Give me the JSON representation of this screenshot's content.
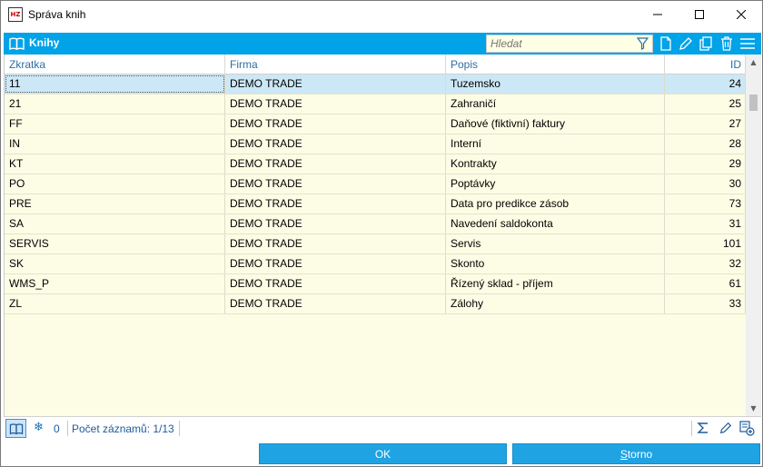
{
  "window": {
    "title": "Správa knih",
    "app_icon_text": "HZ"
  },
  "panel": {
    "title": "Knihy",
    "search_placeholder": "Hledat"
  },
  "grid": {
    "columns": [
      "Zkratka",
      "Firma",
      "Popis",
      "ID"
    ],
    "rows": [
      {
        "zkratka": "11",
        "firma": "DEMO TRADE",
        "popis": "Tuzemsko",
        "id": "24",
        "selected": true
      },
      {
        "zkratka": "21",
        "firma": "DEMO TRADE",
        "popis": "Zahraničí",
        "id": "25"
      },
      {
        "zkratka": "FF",
        "firma": "DEMO TRADE",
        "popis": "Daňové (fiktivní) faktury",
        "id": "27"
      },
      {
        "zkratka": "IN",
        "firma": "DEMO TRADE",
        "popis": "Interní",
        "id": "28"
      },
      {
        "zkratka": "KT",
        "firma": "DEMO TRADE",
        "popis": "Kontrakty",
        "id": "29"
      },
      {
        "zkratka": "PO",
        "firma": "DEMO TRADE",
        "popis": "Poptávky",
        "id": "30"
      },
      {
        "zkratka": "PRE",
        "firma": "DEMO TRADE",
        "popis": "Data pro predikce zásob",
        "id": "73"
      },
      {
        "zkratka": "SA",
        "firma": "DEMO TRADE",
        "popis": "Navedení saldokonta",
        "id": "31"
      },
      {
        "zkratka": "SERVIS",
        "firma": "DEMO TRADE",
        "popis": "Servis",
        "id": "101"
      },
      {
        "zkratka": "SK",
        "firma": "DEMO TRADE",
        "popis": "Skonto",
        "id": "32"
      },
      {
        "zkratka": "WMS_P",
        "firma": "DEMO TRADE",
        "popis": "Řízený sklad - příjem",
        "id": "61"
      },
      {
        "zkratka": "ZL",
        "firma": "DEMO TRADE",
        "popis": "Zálohy",
        "id": "33"
      }
    ]
  },
  "status": {
    "count": "0",
    "records": "Počet záznamů: 1/13"
  },
  "buttons": {
    "ok": "OK",
    "storno_first": "S",
    "storno_rest": "torno"
  },
  "colors": {
    "accent": "#00a2e8",
    "grid_bg": "#fdfde5",
    "selected_row": "#cce8f6",
    "header_text": "#2e6ea5"
  },
  "icons": [
    "book-icon",
    "filter-icon",
    "new-document-icon",
    "edit-pencil-icon",
    "copy-icon",
    "trash-icon",
    "menu-icon",
    "snowflake-icon",
    "sigma-icon",
    "multi-edit-icon"
  ]
}
